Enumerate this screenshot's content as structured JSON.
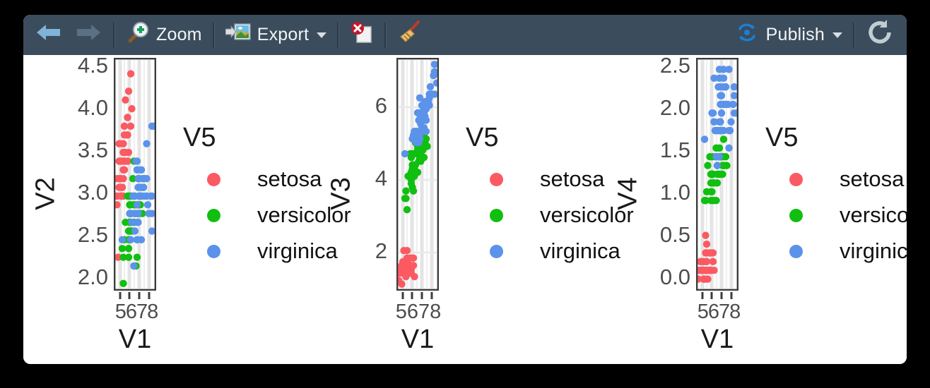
{
  "window": {
    "background": "#000000",
    "panel_background": "#ffffff"
  },
  "toolbar": {
    "background": "#3b4c5c",
    "back_label": "",
    "forward_label": "",
    "zoom_label": "Zoom",
    "export_label": "Export",
    "delete_label": "",
    "clear_label": "",
    "publish_label": "Publish",
    "refresh_label": "",
    "icons": {
      "back": "arrow-left-icon",
      "forward": "arrow-right-icon",
      "zoom": "magnifier-plus-icon",
      "export": "export-image-icon",
      "delete": "delete-document-icon",
      "clear": "broom-icon",
      "publish": "publish-icon",
      "refresh": "refresh-icon"
    }
  },
  "colors": {
    "setosa": "#fb5a62",
    "versicolor": "#10bf10",
    "virginica": "#5b92ea",
    "panel_border": "#3c3c3c",
    "gridline": "#e2e2e2",
    "tick_text": "#4d4d4d",
    "label_text": "#1a1a1a"
  },
  "legend": {
    "title": "V5",
    "entries": [
      {
        "label": "setosa",
        "color": "#fb5a62"
      },
      {
        "label": "versicolor",
        "color": "#10bf10"
      },
      {
        "label": "virginica",
        "color": "#5b92ea"
      }
    ]
  },
  "chart_data": [
    {
      "type": "scatter",
      "title": "",
      "xlabel": "V1",
      "ylabel": "V2",
      "xlim": [
        4.3,
        7.9
      ],
      "ylim": [
        1.95,
        4.55
      ],
      "xticks": [
        5,
        6,
        7,
        8
      ],
      "yticks": [
        2.0,
        2.5,
        3.0,
        3.5,
        4.0,
        4.5
      ],
      "ytick_labels": [
        "2.0",
        "2.5",
        "3.0",
        "3.5",
        "4.0",
        "4.5"
      ],
      "xtick_labels": [
        "5",
        "6",
        "7",
        "8"
      ],
      "grid": "vertical",
      "legend_title": "V5",
      "legend_position": "right",
      "series": [
        {
          "name": "setosa",
          "color": "#fb5a62",
          "x": [
            5.1,
            4.9,
            4.7,
            4.6,
            5.0,
            5.4,
            4.6,
            5.0,
            4.4,
            4.9,
            5.4,
            4.8,
            4.8,
            4.3,
            5.8,
            5.7,
            5.4,
            5.1,
            5.7,
            5.1,
            5.4,
            5.1,
            4.6,
            5.1,
            4.8,
            5.0,
            5.0,
            5.2,
            5.2,
            4.7,
            4.8,
            5.4,
            5.2,
            5.5,
            4.9,
            5.0,
            5.5,
            4.9,
            4.4,
            5.1,
            5.0,
            4.5,
            4.4,
            5.0,
            5.1,
            4.8,
            5.1,
            4.6,
            5.3,
            5.0
          ],
          "y": [
            3.5,
            3.0,
            3.2,
            3.1,
            3.6,
            3.9,
            3.4,
            3.4,
            2.9,
            3.1,
            3.7,
            3.4,
            3.0,
            3.0,
            4.0,
            4.4,
            3.9,
            3.5,
            3.8,
            3.8,
            3.4,
            3.7,
            3.6,
            3.3,
            3.4,
            3.0,
            3.4,
            3.5,
            3.4,
            3.2,
            3.1,
            3.4,
            4.1,
            4.2,
            3.1,
            3.2,
            3.5,
            3.6,
            3.0,
            3.4,
            3.5,
            2.3,
            3.2,
            3.5,
            3.8,
            3.0,
            3.8,
            3.2,
            3.7,
            3.3
          ]
        },
        {
          "name": "versicolor",
          "color": "#10bf10",
          "x": [
            7.0,
            6.4,
            6.9,
            5.5,
            6.5,
            5.7,
            6.3,
            4.9,
            6.6,
            5.2,
            5.0,
            5.9,
            6.0,
            6.1,
            5.6,
            6.7,
            5.6,
            5.8,
            6.2,
            5.6,
            5.9,
            6.1,
            6.3,
            6.1,
            6.4,
            6.6,
            6.8,
            6.7,
            6.0,
            5.7,
            5.5,
            5.5,
            5.8,
            6.0,
            5.4,
            6.0,
            6.7,
            6.3,
            5.6,
            5.5,
            5.5,
            6.1,
            5.8,
            5.0,
            5.6,
            5.7,
            5.7,
            6.2,
            5.1,
            5.7
          ],
          "y": [
            3.2,
            3.2,
            3.1,
            2.3,
            2.8,
            2.8,
            3.3,
            2.4,
            2.9,
            2.7,
            2.0,
            3.0,
            2.2,
            2.9,
            2.9,
            3.1,
            3.0,
            2.7,
            2.2,
            2.5,
            3.2,
            2.8,
            2.5,
            2.8,
            2.9,
            3.0,
            2.8,
            3.0,
            2.9,
            2.6,
            2.4,
            2.4,
            2.7,
            2.7,
            3.0,
            3.4,
            3.1,
            2.3,
            3.0,
            2.5,
            2.6,
            3.0,
            2.6,
            2.3,
            2.7,
            3.0,
            2.9,
            2.9,
            2.5,
            2.8
          ]
        },
        {
          "name": "virginica",
          "color": "#5b92ea",
          "x": [
            6.3,
            5.8,
            7.1,
            6.3,
            6.5,
            7.6,
            4.9,
            7.3,
            6.7,
            7.2,
            6.5,
            6.4,
            6.8,
            5.7,
            5.8,
            6.4,
            6.5,
            7.7,
            7.7,
            6.0,
            6.9,
            5.6,
            7.7,
            6.3,
            6.7,
            7.2,
            6.2,
            6.1,
            6.4,
            7.2,
            7.4,
            7.9,
            6.4,
            6.3,
            6.1,
            7.7,
            6.3,
            6.4,
            6.0,
            6.9,
            6.7,
            6.9,
            5.8,
            6.8,
            6.7,
            6.7,
            6.3,
            6.5,
            6.2,
            5.9
          ],
          "y": [
            3.3,
            2.7,
            3.0,
            2.9,
            3.0,
            3.0,
            2.5,
            2.9,
            2.5,
            3.6,
            3.2,
            2.7,
            3.0,
            2.5,
            2.8,
            3.2,
            3.0,
            3.8,
            2.6,
            2.2,
            3.2,
            2.8,
            2.8,
            2.7,
            3.3,
            3.2,
            2.8,
            3.0,
            2.8,
            3.0,
            2.8,
            3.8,
            2.8,
            2.8,
            2.6,
            3.0,
            3.4,
            3.1,
            3.0,
            3.1,
            3.1,
            3.1,
            2.7,
            3.2,
            3.3,
            3.0,
            2.5,
            3.0,
            3.4,
            3.0
          ]
        }
      ]
    },
    {
      "type": "scatter",
      "title": "",
      "xlabel": "V1",
      "ylabel": "V3",
      "xlim": [
        4.3,
        7.9
      ],
      "ylim": [
        0.9,
        7.0
      ],
      "xticks": [
        5,
        6,
        7,
        8
      ],
      "yticks": [
        2,
        4,
        6
      ],
      "ytick_labels": [
        "2",
        "4",
        "6"
      ],
      "xtick_labels": [
        "5",
        "6",
        "7",
        "8"
      ],
      "grid": "vertical",
      "legend_title": "V5",
      "legend_position": "right",
      "series": [
        {
          "name": "setosa",
          "color": "#fb5a62",
          "x": [
            5.1,
            4.9,
            4.7,
            4.6,
            5.0,
            5.4,
            4.6,
            5.0,
            4.4,
            4.9,
            5.4,
            4.8,
            4.8,
            4.3,
            5.8,
            5.7,
            5.4,
            5.1,
            5.7,
            5.1,
            5.4,
            5.1,
            4.6,
            5.1,
            4.8,
            5.0,
            5.0,
            5.2,
            5.2,
            4.7,
            4.8,
            5.4,
            5.2,
            5.5,
            4.9,
            5.0,
            5.5,
            4.9,
            4.4,
            5.1,
            5.0,
            4.5,
            4.4,
            5.0,
            5.1,
            4.8,
            5.1,
            4.6,
            5.3,
            5.0
          ],
          "y": [
            1.4,
            1.4,
            1.3,
            1.5,
            1.4,
            1.7,
            1.4,
            1.5,
            1.4,
            1.5,
            1.5,
            1.6,
            1.4,
            1.1,
            1.2,
            1.5,
            1.3,
            1.4,
            1.7,
            1.5,
            1.7,
            1.5,
            1.0,
            1.7,
            1.9,
            1.6,
            1.6,
            1.5,
            1.4,
            1.6,
            1.6,
            1.5,
            1.5,
            1.4,
            1.5,
            1.2,
            1.3,
            1.4,
            1.3,
            1.5,
            1.3,
            1.3,
            1.3,
            1.6,
            1.9,
            1.4,
            1.6,
            1.4,
            1.5,
            1.4
          ]
        },
        {
          "name": "versicolor",
          "color": "#10bf10",
          "x": [
            7.0,
            6.4,
            6.9,
            5.5,
            6.5,
            5.7,
            6.3,
            4.9,
            6.6,
            5.2,
            5.0,
            5.9,
            6.0,
            6.1,
            5.6,
            6.7,
            5.6,
            5.8,
            6.2,
            5.6,
            5.9,
            6.1,
            6.3,
            6.1,
            6.4,
            6.6,
            6.8,
            6.7,
            6.0,
            5.7,
            5.5,
            5.5,
            5.8,
            6.0,
            5.4,
            6.0,
            6.7,
            6.3,
            5.6,
            5.5,
            5.5,
            6.1,
            5.8,
            5.0,
            5.6,
            5.7,
            5.7,
            6.2,
            5.1,
            5.7
          ],
          "y": [
            4.7,
            4.5,
            4.9,
            4.0,
            4.6,
            4.5,
            4.7,
            3.3,
            4.6,
            3.9,
            3.5,
            4.2,
            4.0,
            4.7,
            3.6,
            4.4,
            4.5,
            4.1,
            4.5,
            3.9,
            4.8,
            4.0,
            4.9,
            4.7,
            4.3,
            4.4,
            4.8,
            5.0,
            4.5,
            3.5,
            3.8,
            3.7,
            3.9,
            5.1,
            4.5,
            4.5,
            4.7,
            4.4,
            4.1,
            4.0,
            4.4,
            4.6,
            4.0,
            3.3,
            4.2,
            4.2,
            4.2,
            4.3,
            3.0,
            4.1
          ]
        },
        {
          "name": "virginica",
          "color": "#5b92ea",
          "x": [
            6.3,
            5.8,
            7.1,
            6.3,
            6.5,
            7.6,
            4.9,
            7.3,
            6.7,
            7.2,
            6.5,
            6.4,
            6.8,
            5.7,
            5.8,
            6.4,
            6.5,
            7.7,
            7.7,
            6.0,
            6.9,
            5.6,
            7.7,
            6.3,
            6.7,
            7.2,
            6.2,
            6.1,
            6.4,
            7.2,
            7.4,
            7.9,
            6.4,
            6.3,
            6.1,
            7.7,
            6.3,
            6.4,
            6.0,
            6.9,
            6.7,
            6.9,
            5.8,
            6.8,
            6.7,
            6.7,
            6.3,
            6.5,
            6.2,
            5.9
          ],
          "y": [
            6.0,
            5.1,
            5.9,
            5.6,
            5.8,
            6.6,
            4.5,
            6.3,
            5.8,
            6.1,
            5.1,
            5.3,
            5.5,
            5.0,
            5.1,
            5.3,
            5.5,
            6.7,
            6.9,
            5.0,
            5.7,
            4.9,
            6.7,
            4.9,
            5.7,
            6.0,
            4.8,
            4.9,
            5.6,
            5.8,
            6.1,
            6.4,
            5.6,
            5.1,
            5.6,
            6.1,
            5.6,
            5.5,
            4.8,
            5.4,
            5.6,
            5.1,
            5.1,
            5.9,
            5.7,
            5.2,
            5.0,
            5.2,
            5.4,
            5.1
          ]
        }
      ]
    },
    {
      "type": "scatter",
      "title": "",
      "xlabel": "V1",
      "ylabel": "V4",
      "xlim": [
        4.3,
        7.9
      ],
      "ylim": [
        0.0,
        2.6
      ],
      "xticks": [
        5,
        6,
        7,
        8
      ],
      "yticks": [
        0.0,
        0.5,
        1.0,
        1.5,
        2.0,
        2.5
      ],
      "ytick_labels": [
        "0.0",
        "0.5",
        "1.0",
        "1.5",
        "2.0",
        "2.5"
      ],
      "xtick_labels": [
        "5",
        "6",
        "7",
        "8"
      ],
      "grid": "vertical",
      "legend_title": "V5",
      "legend_position": "right",
      "series": [
        {
          "name": "setosa",
          "color": "#fb5a62",
          "x": [
            5.1,
            4.9,
            4.7,
            4.6,
            5.0,
            5.4,
            4.6,
            5.0,
            4.4,
            4.9,
            5.4,
            4.8,
            4.8,
            4.3,
            5.8,
            5.7,
            5.4,
            5.1,
            5.7,
            5.1,
            5.4,
            5.1,
            4.6,
            5.1,
            4.8,
            5.0,
            5.0,
            5.2,
            5.2,
            4.7,
            4.8,
            5.4,
            5.2,
            5.5,
            4.9,
            5.0,
            5.5,
            4.9,
            4.4,
            5.1,
            5.0,
            4.5,
            4.4,
            5.0,
            5.1,
            4.8,
            5.1,
            4.6,
            5.3,
            5.0
          ],
          "y": [
            0.2,
            0.2,
            0.2,
            0.2,
            0.2,
            0.4,
            0.3,
            0.2,
            0.2,
            0.1,
            0.2,
            0.2,
            0.1,
            0.1,
            0.2,
            0.4,
            0.4,
            0.3,
            0.3,
            0.3,
            0.2,
            0.4,
            0.2,
            0.5,
            0.2,
            0.2,
            0.4,
            0.2,
            0.2,
            0.2,
            0.2,
            0.4,
            0.1,
            0.2,
            0.2,
            0.2,
            0.2,
            0.1,
            0.2,
            0.2,
            0.3,
            0.3,
            0.2,
            0.6,
            0.4,
            0.3,
            0.2,
            0.2,
            0.2,
            0.2
          ]
        },
        {
          "name": "versicolor",
          "color": "#10bf10",
          "x": [
            7.0,
            6.4,
            6.9,
            5.5,
            6.5,
            5.7,
            6.3,
            4.9,
            6.6,
            5.2,
            5.0,
            5.9,
            6.0,
            6.1,
            5.6,
            6.7,
            5.6,
            5.8,
            6.2,
            5.6,
            5.9,
            6.1,
            6.3,
            6.1,
            6.4,
            6.6,
            6.8,
            6.7,
            6.0,
            5.7,
            5.5,
            5.5,
            5.8,
            6.0,
            5.4,
            6.0,
            6.7,
            6.3,
            5.6,
            5.5,
            5.5,
            6.1,
            5.8,
            5.0,
            5.6,
            5.7,
            5.7,
            6.2,
            5.1,
            5.7
          ],
          "y": [
            1.4,
            1.5,
            1.5,
            1.3,
            1.5,
            1.3,
            1.6,
            1.0,
            1.3,
            1.4,
            1.0,
            1.5,
            1.0,
            1.4,
            1.3,
            1.4,
            1.5,
            1.0,
            1.5,
            1.1,
            1.8,
            1.3,
            1.5,
            1.2,
            1.3,
            1.4,
            1.4,
            1.7,
            1.5,
            1.0,
            1.1,
            1.0,
            1.2,
            1.6,
            1.5,
            1.6,
            1.5,
            1.3,
            1.3,
            1.3,
            1.2,
            1.4,
            1.2,
            1.0,
            1.3,
            1.2,
            1.3,
            1.3,
            1.1,
            1.3
          ]
        },
        {
          "name": "virginica",
          "color": "#5b92ea",
          "x": [
            6.3,
            5.8,
            7.1,
            6.3,
            6.5,
            7.6,
            4.9,
            7.3,
            6.7,
            7.2,
            6.5,
            6.4,
            6.8,
            5.7,
            5.8,
            6.4,
            6.5,
            7.7,
            7.7,
            6.0,
            6.9,
            5.6,
            7.7,
            6.3,
            6.7,
            7.2,
            6.2,
            6.1,
            6.4,
            7.2,
            7.4,
            7.9,
            6.4,
            6.3,
            6.1,
            7.7,
            6.3,
            6.4,
            6.0,
            6.9,
            6.7,
            6.9,
            5.8,
            6.8,
            6.7,
            6.7,
            6.3,
            6.5,
            6.2,
            5.9
          ],
          "y": [
            2.5,
            1.9,
            2.1,
            1.8,
            2.2,
            2.1,
            1.7,
            1.8,
            1.8,
            2.5,
            2.0,
            1.9,
            2.1,
            2.0,
            2.4,
            2.3,
            1.8,
            2.2,
            2.3,
            1.5,
            2.3,
            2.0,
            2.0,
            1.8,
            2.1,
            1.8,
            1.8,
            1.8,
            2.1,
            1.6,
            1.9,
            2.0,
            2.2,
            1.5,
            1.4,
            2.3,
            2.4,
            1.8,
            1.8,
            2.1,
            2.4,
            2.3,
            1.9,
            2.3,
            2.5,
            2.3,
            1.9,
            2.0,
            2.3,
            1.8
          ]
        }
      ]
    }
  ]
}
